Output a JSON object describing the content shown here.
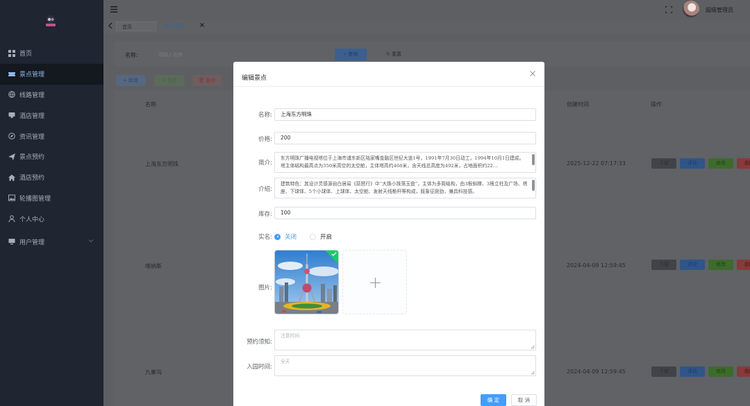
{
  "header": {
    "username": "超级管理员"
  },
  "sidebar": {
    "items": [
      {
        "label": "首页",
        "icon": "grid-icon"
      },
      {
        "label": "景点管理",
        "icon": "ticket-icon",
        "active": true
      },
      {
        "label": "线路管理",
        "icon": "globe-icon"
      },
      {
        "label": "酒店管理",
        "icon": "hotel-icon"
      },
      {
        "label": "资讯管理",
        "icon": "compass-icon"
      },
      {
        "label": "景点预约",
        "icon": "send-icon"
      },
      {
        "label": "酒店预约",
        "icon": "home-icon"
      },
      {
        "label": "轮播图管理",
        "icon": "image-icon"
      },
      {
        "label": "个人中心",
        "icon": "user-icon"
      },
      {
        "label": "用户管理",
        "icon": "monitor-icon"
      }
    ]
  },
  "tabs": [
    {
      "label": "首页"
    },
    {
      "label": "景点管理"
    }
  ],
  "search": {
    "label": "名称:",
    "placeholder": "请输入名称",
    "query_label": "查询",
    "reset_label": "重置"
  },
  "toolbar": {
    "add_label": "新增",
    "edit_label": "修改",
    "delete_label": "删除"
  },
  "table": {
    "headers": {
      "name": "名称",
      "created": "创建时间",
      "ops": "操作"
    },
    "rows": [
      {
        "name": "上海东方明珠",
        "created": "2025-12-22 07:17:33"
      },
      {
        "name": "喀纳斯",
        "created": "2024-04-09 12:59:45"
      },
      {
        "name": "九寨沟",
        "created": "2024-04-09 12:59:45"
      }
    ],
    "ops": {
      "down": "下架",
      "comment": "评论",
      "edit": "修改",
      "delete": "删除"
    }
  },
  "modal": {
    "title": "编辑景点",
    "fields": {
      "name_label": "名称",
      "name_value": "上海东方明珠",
      "price_label": "价格",
      "price_value": "200",
      "intro_label": "简介",
      "intro_value": "东方明珠广播电视塔位于上海市浦东新区陆家嘴金融区世纪大道1号，1991年7月30日动工，1994年10月1日建成。塔主体结构最高点为350米高空的太空舱，主体塔高约468米，含天线总高度为492米，占地面积约22…",
      "desc_label": "介绍",
      "desc_value": "建筑特色：其设计灵感源自白居易《琵琶行》中“大珠小珠落玉盘”，主体为多筒结构，由3根斜撑、3根立柱及广场、塔座、下球体、5个小球体、上球体、太空舱、发射天线桅杆等构成，既象征刚劲，兼具科技感。",
      "stock_label": "库存",
      "stock_value": "100",
      "realname_label": "实名",
      "realname_options": [
        "关闭",
        "开启"
      ],
      "image_label": "图片",
      "notice_label": "预约须知",
      "notice_placeholder": "注意时间",
      "entry_label": "入园时间",
      "entry_placeholder": "全天"
    },
    "ok_label": "确 定",
    "cancel_label": "取 消"
  },
  "colors": {
    "primary": "#409eff",
    "sidebar": "#1f2531",
    "success": "#13ce66"
  }
}
